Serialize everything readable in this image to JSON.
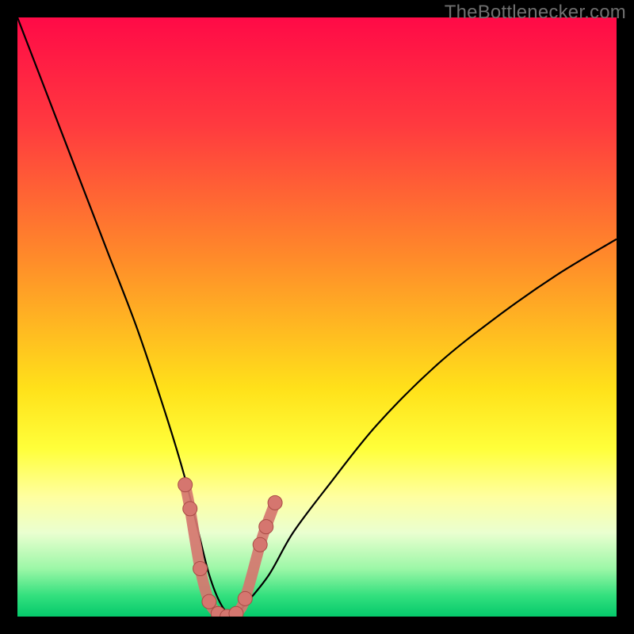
{
  "watermark": "TheBottlenecker.com",
  "colors": {
    "gradient_stops": [
      {
        "offset": 0.0,
        "color": "#ff0a47"
      },
      {
        "offset": 0.18,
        "color": "#ff3a3f"
      },
      {
        "offset": 0.4,
        "color": "#ff8a2a"
      },
      {
        "offset": 0.62,
        "color": "#ffe11a"
      },
      {
        "offset": 0.72,
        "color": "#ffff3a"
      },
      {
        "offset": 0.8,
        "color": "#ffffa0"
      },
      {
        "offset": 0.86,
        "color": "#eaffd0"
      },
      {
        "offset": 0.92,
        "color": "#9cf7a7"
      },
      {
        "offset": 0.965,
        "color": "#33e07e"
      },
      {
        "offset": 1.0,
        "color": "#05c96b"
      }
    ],
    "curve": "#000000",
    "marker_fill": "#d5766f",
    "marker_stroke": "#a94b45"
  },
  "chart_data": {
    "type": "line",
    "title": "",
    "xlabel": "",
    "ylabel": "",
    "xlim": [
      0,
      100
    ],
    "ylim": [
      0,
      100
    ],
    "series": [
      {
        "name": "bottleneck-curve",
        "x": [
          0,
          5,
          10,
          15,
          20,
          25,
          28,
          30,
          32,
          34,
          36,
          38,
          42,
          46,
          52,
          60,
          70,
          80,
          90,
          100
        ],
        "y": [
          100,
          87,
          74,
          61,
          48,
          33,
          23,
          15,
          7,
          2,
          0,
          2,
          7,
          14,
          22,
          32,
          42,
          50,
          57,
          63
        ]
      }
    ],
    "markers": {
      "name": "highlight-points",
      "x": [
        28.0,
        28.8,
        30.5,
        32.0,
        33.5,
        35.0,
        36.5,
        38.0,
        40.5,
        41.5,
        43.0
      ],
      "y": [
        22.0,
        18.0,
        8.0,
        2.5,
        0.5,
        0.0,
        0.5,
        3.0,
        12.0,
        15.0,
        19.0
      ]
    }
  }
}
